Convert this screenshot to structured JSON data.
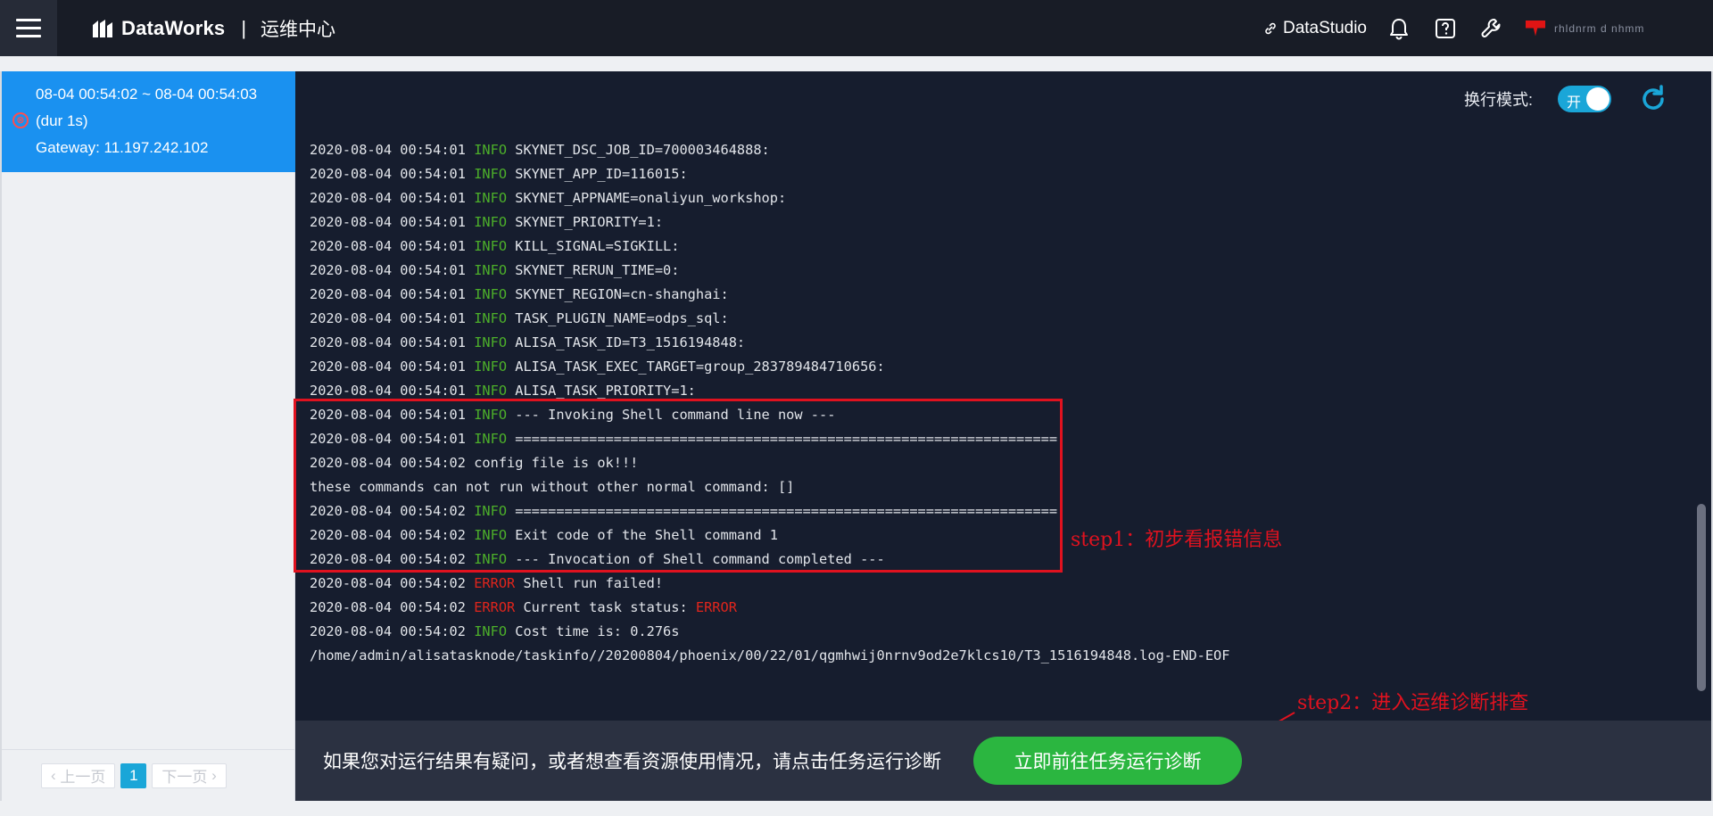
{
  "header": {
    "brand_name": "DataWorks",
    "separator": "|",
    "module": "运维中心",
    "datastudio_label": "DataStudio",
    "user_name": "rhldnrm d nhmm"
  },
  "run_list": {
    "items": [
      {
        "time_range": "08-04 00:54:02 ~ 08-04 00:54:03",
        "duration": "(dur 1s)",
        "gateway": "Gateway: 11.197.242.102",
        "status": "error"
      }
    ]
  },
  "pagination": {
    "prev": "上一页",
    "current": "1",
    "next": "下一页"
  },
  "log_toolbar": {
    "wrap_label": "换行模式:",
    "toggle_text": "开"
  },
  "log_lines": [
    {
      "ts": "2020-08-04 00:54:01",
      "level": "INFO",
      "msg": "SKYNET_DSC_JOB_ID=700003464888:"
    },
    {
      "ts": "2020-08-04 00:54:01",
      "level": "INFO",
      "msg": "SKYNET_APP_ID=116015:"
    },
    {
      "ts": "2020-08-04 00:54:01",
      "level": "INFO",
      "msg": "SKYNET_APPNAME=onaliyun_workshop:"
    },
    {
      "ts": "2020-08-04 00:54:01",
      "level": "INFO",
      "msg": "SKYNET_PRIORITY=1:"
    },
    {
      "ts": "2020-08-04 00:54:01",
      "level": "INFO",
      "msg": "KILL_SIGNAL=SIGKILL:"
    },
    {
      "ts": "2020-08-04 00:54:01",
      "level": "INFO",
      "msg": "SKYNET_RERUN_TIME=0:"
    },
    {
      "ts": "2020-08-04 00:54:01",
      "level": "INFO",
      "msg": "SKYNET_REGION=cn-shanghai:"
    },
    {
      "ts": "2020-08-04 00:54:01",
      "level": "INFO",
      "msg": "TASK_PLUGIN_NAME=odps_sql:"
    },
    {
      "ts": "2020-08-04 00:54:01",
      "level": "INFO",
      "msg": "ALISA_TASK_ID=T3_1516194848:"
    },
    {
      "ts": "2020-08-04 00:54:01",
      "level": "INFO",
      "msg": "ALISA_TASK_EXEC_TARGET=group_283789484710656:"
    },
    {
      "ts": "2020-08-04 00:54:01",
      "level": "INFO",
      "msg": "ALISA_TASK_PRIORITY=1:"
    },
    {
      "ts": "2020-08-04 00:54:01",
      "level": "INFO",
      "msg": "--- Invoking Shell command line now ---"
    },
    {
      "ts": "2020-08-04 00:54:01",
      "level": "INFO",
      "msg": "=================================================================="
    },
    {
      "ts": "2020-08-04 00:54:02",
      "level": "",
      "msg": "config file is ok!!!"
    },
    {
      "ts": "",
      "level": "",
      "msg": "these commands can not run without other normal command: []"
    },
    {
      "ts": "2020-08-04 00:54:02",
      "level": "INFO",
      "msg": "=================================================================="
    },
    {
      "ts": "2020-08-04 00:54:02",
      "level": "INFO",
      "msg": "Exit code of the Shell command 1"
    },
    {
      "ts": "2020-08-04 00:54:02",
      "level": "INFO",
      "msg": "--- Invocation of Shell command completed ---"
    },
    {
      "ts": "2020-08-04 00:54:02",
      "level": "ERROR",
      "msg": "Shell run failed!"
    },
    {
      "ts": "2020-08-04 00:54:02",
      "level": "ERROR",
      "msg": "Current task status: ",
      "tail": "ERROR"
    },
    {
      "ts": "2020-08-04 00:54:02",
      "level": "INFO",
      "msg": "Cost time is: 0.276s"
    },
    {
      "ts": "",
      "level": "",
      "msg": "/home/admin/alisatasknode/taskinfo//20200804/phoenix/00/22/01/qgmhwij0nrnv9od2e7klcs10/T3_1516194848.log-END-EOF"
    }
  ],
  "annotations": {
    "step1": "step1：初步看报错信息",
    "step2": "step2：进入运维诊断排查",
    "color": "#e0121f"
  },
  "diagnostic": {
    "prompt": "如果您对运行结果有疑问，或者想查看资源使用情况，请点击任务运行诊断",
    "button_label": "立即前往任务运行诊断"
  },
  "colors": {
    "accent": "#1a91f0",
    "toggle": "#1aa6d8",
    "success": "#2bb640",
    "info": "#4caf2a",
    "error": "#e0251c"
  }
}
